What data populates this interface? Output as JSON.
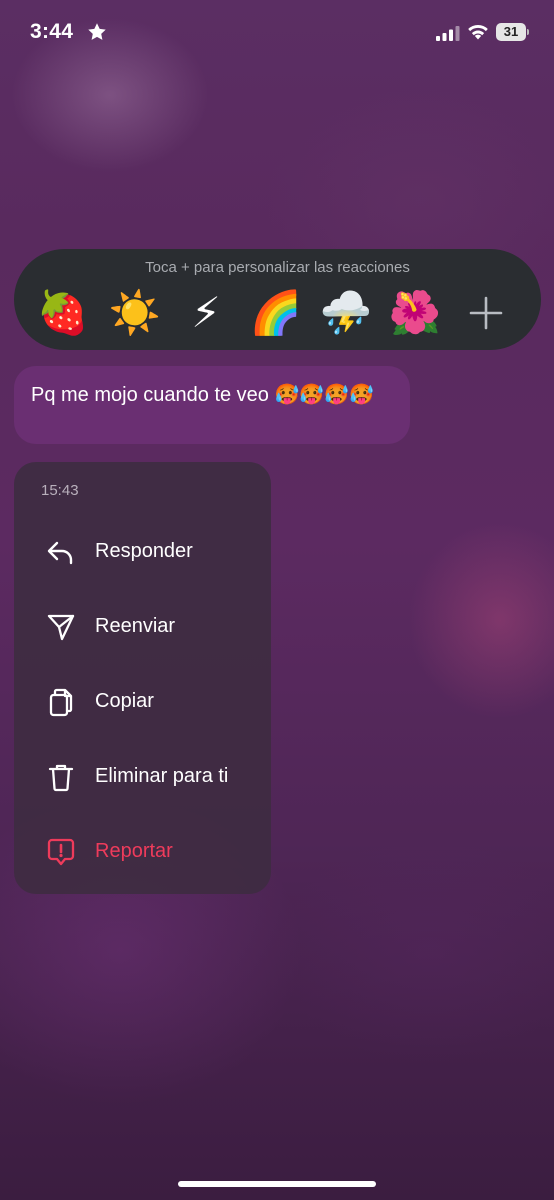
{
  "status_bar": {
    "time": "3:44",
    "battery_level": "31"
  },
  "reactions": {
    "hint": "Toca + para personalizar las reacciones",
    "emojis": [
      {
        "icon": "strawberry",
        "glyph": "🍓"
      },
      {
        "icon": "sun",
        "glyph": "☀️"
      },
      {
        "icon": "lightning",
        "glyph": "⚡"
      },
      {
        "icon": "rainbow",
        "glyph": "🌈"
      },
      {
        "icon": "cloud-rain-lightning",
        "glyph": "⛈️"
      },
      {
        "icon": "hibiscus",
        "glyph": "🌺"
      }
    ],
    "more_icon": "plus"
  },
  "message": {
    "text": "Pq me mojo cuando te veo 🥵🥵🥵🥵"
  },
  "context_menu": {
    "timestamp": "15:43",
    "items": [
      {
        "label": "Responder",
        "icon": "reply"
      },
      {
        "label": "Reenviar",
        "icon": "send"
      },
      {
        "label": "Copiar",
        "icon": "copy"
      },
      {
        "label": "Eliminar para ti",
        "icon": "trash"
      },
      {
        "label": "Reportar",
        "icon": "report",
        "color": "#ee3b5b"
      }
    ]
  },
  "colors": {
    "accent_danger": "#ee3b5b",
    "bubble": "#6a2f72",
    "reaction_bar": "#2a2d31"
  }
}
